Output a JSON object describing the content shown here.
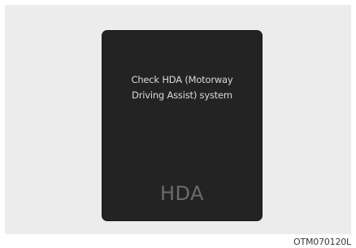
{
  "display": {
    "message_line1": "Check HDA (Motorway",
    "message_line2": "Driving Assist) system",
    "indicator_label": "HDA"
  },
  "figure_code": "OTM070120L",
  "colors": {
    "background_panel": "#ececec",
    "cluster_screen": "#232323",
    "message_text": "#d9d9d9",
    "indicator_text": "#6b6b6b"
  }
}
